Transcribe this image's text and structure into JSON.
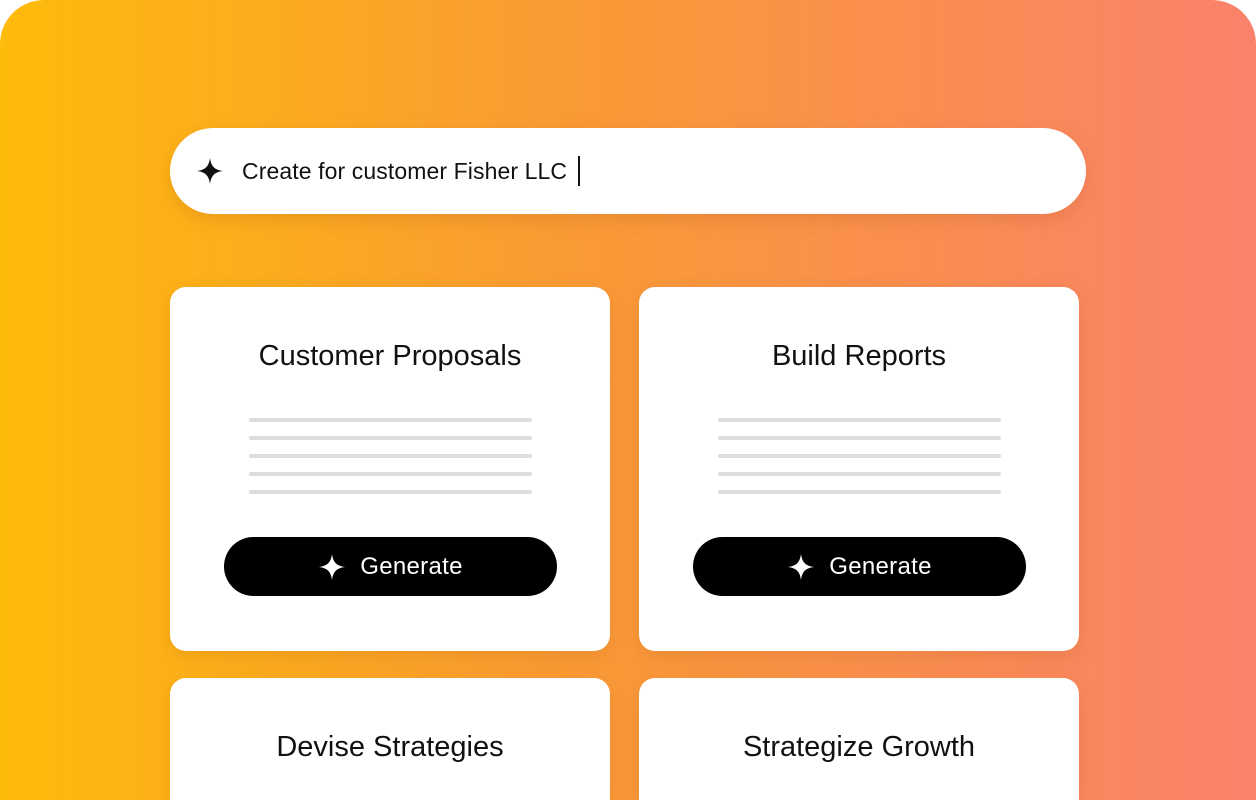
{
  "background": {
    "gradient_start": "#fdbb0b",
    "gradient_mid": "#fa9a34",
    "gradient_end": "#f9826b"
  },
  "prompt": {
    "icon": "sparkle-icon",
    "text": "Create for customer Fisher LLC"
  },
  "cards": [
    {
      "title": "Customer Proposals",
      "button_label": "Generate",
      "button_icon": "sparkle-icon"
    },
    {
      "title": "Build Reports",
      "button_label": "Generate",
      "button_icon": "sparkle-icon"
    },
    {
      "title": "Devise Strategies"
    },
    {
      "title": "Strategize Growth"
    }
  ]
}
